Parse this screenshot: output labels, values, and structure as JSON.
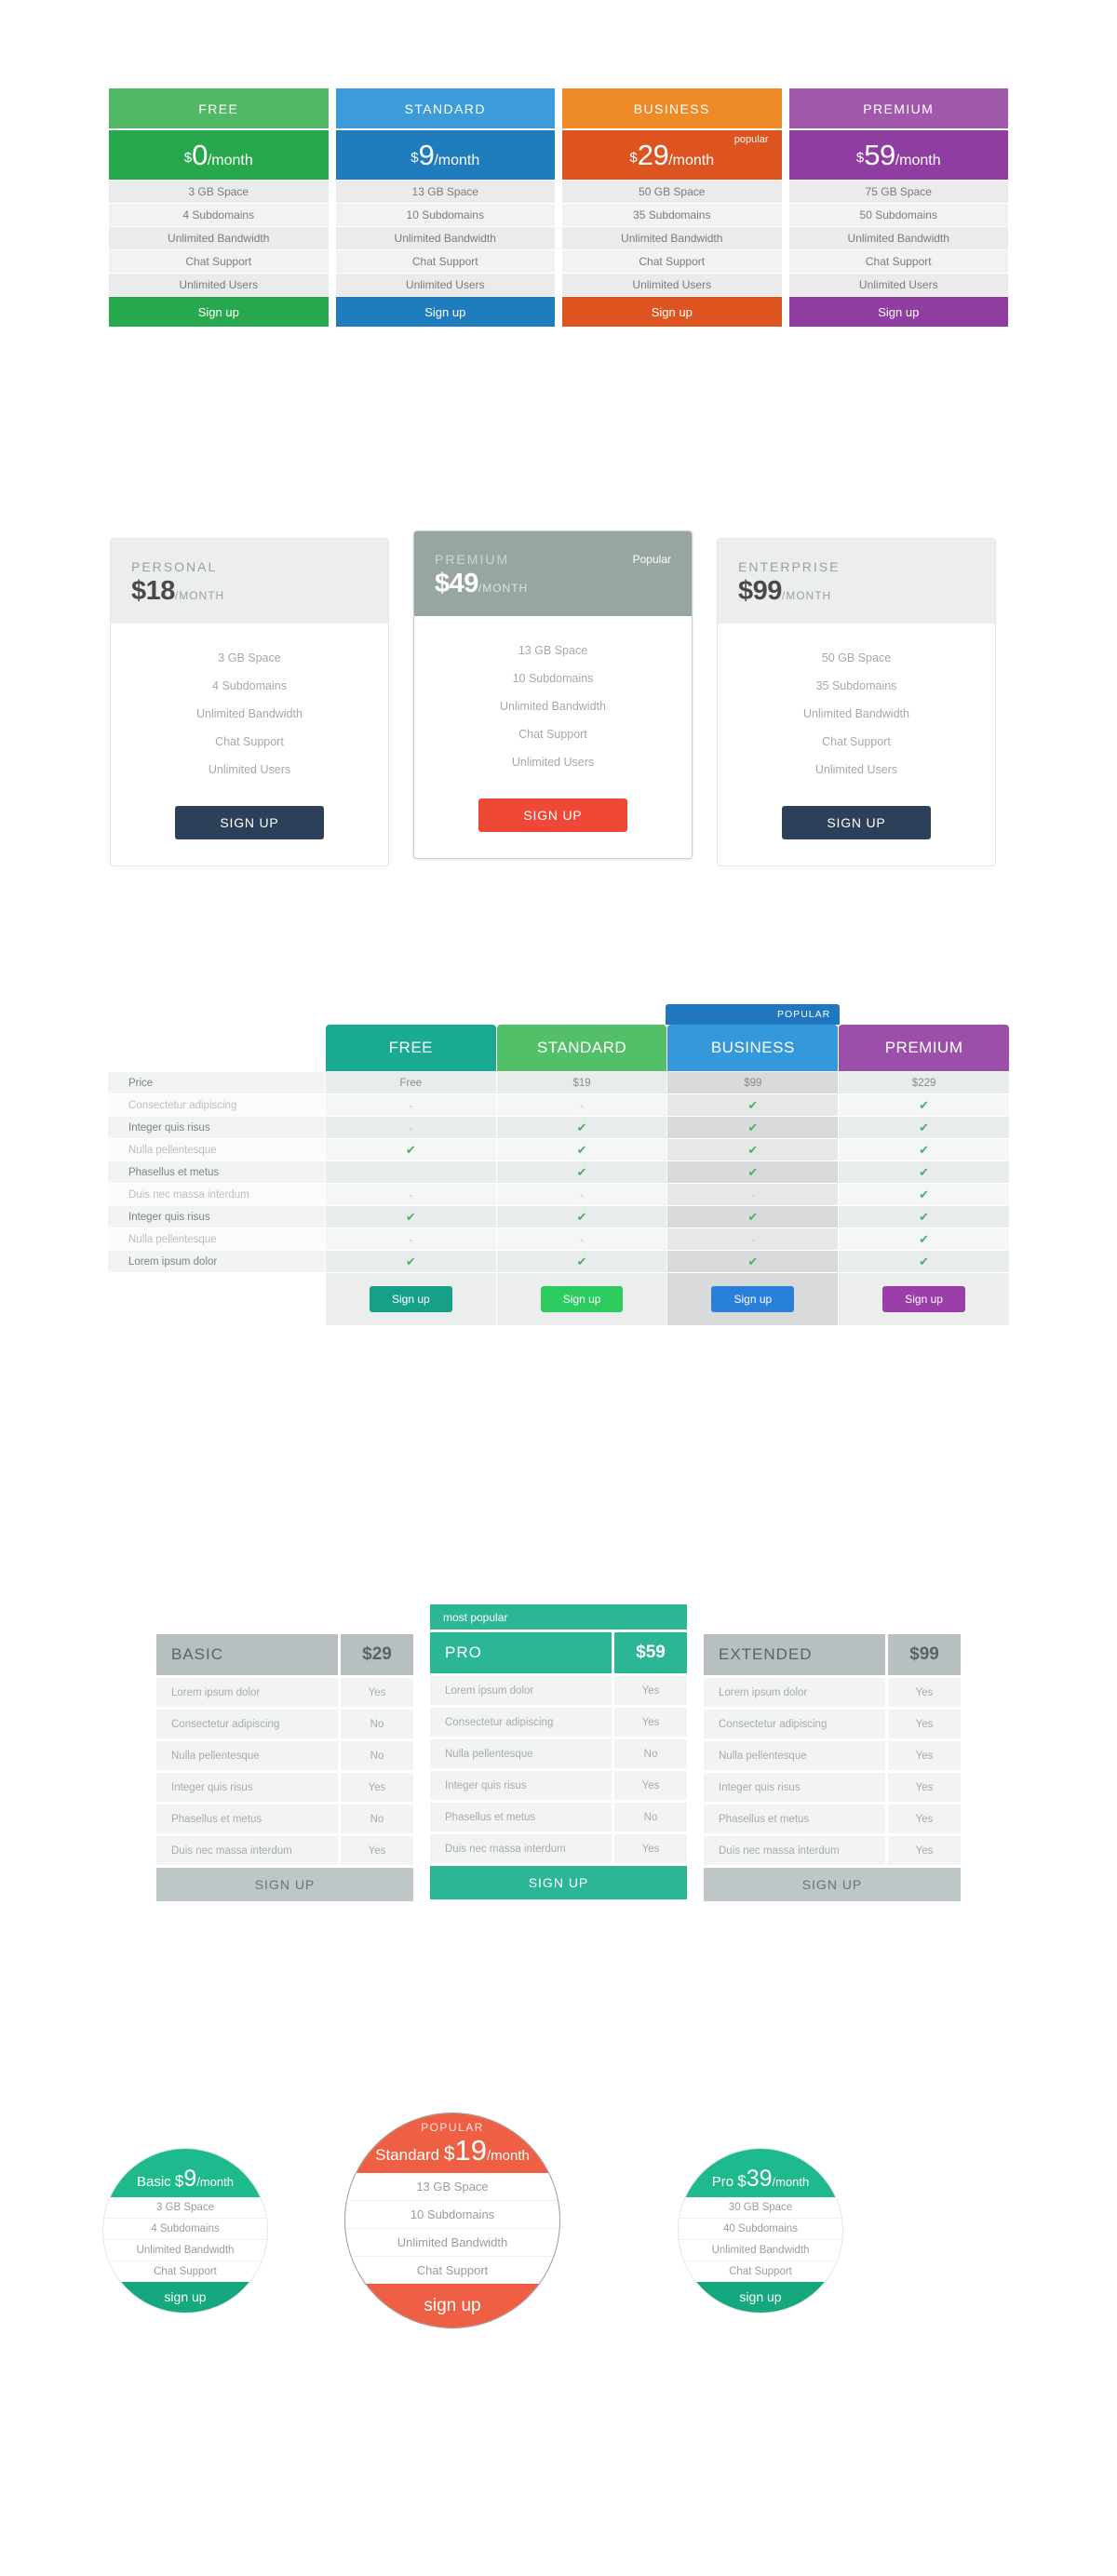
{
  "section1": {
    "columns": [
      {
        "name": "FREE",
        "currency": "$",
        "amount": "0",
        "period": "/month",
        "badge": "",
        "header_color": "#4fb968",
        "price_color": "#27a84c",
        "cta_color": "#27a84c",
        "features": [
          "3 GB Space",
          "4 Subdomains",
          "Unlimited Bandwidth",
          "Chat Support",
          "Unlimited Users"
        ],
        "cta": "Sign up"
      },
      {
        "name": "STANDARD",
        "currency": "$",
        "amount": "9",
        "period": "/month",
        "badge": "",
        "header_color": "#3b9cd9",
        "price_color": "#1f7dbd",
        "cta_color": "#1f7dbd",
        "features": [
          "13 GB Space",
          "10 Subdomains",
          "Unlimited Bandwidth",
          "Chat Support",
          "Unlimited Users"
        ],
        "cta": "Sign up"
      },
      {
        "name": "BUSINESS",
        "currency": "$",
        "amount": "29",
        "period": "/month",
        "badge": "popular",
        "header_color": "#ef8b26",
        "price_color": "#de5421",
        "cta_color": "#de5421",
        "features": [
          "50 GB Space",
          "35 Subdomains",
          "Unlimited Bandwidth",
          "Chat Support",
          "Unlimited Users"
        ],
        "cta": "Sign up"
      },
      {
        "name": "PREMIUM",
        "currency": "$",
        "amount": "59",
        "period": "/month",
        "badge": "",
        "header_color": "#a059ab",
        "price_color": "#8f3da0",
        "cta_color": "#8f3da0",
        "features": [
          "75 GB Space",
          "50 Subdomains",
          "Unlimited Bandwidth",
          "Chat Support",
          "Unlimited Users"
        ],
        "cta": "Sign up"
      }
    ]
  },
  "section2": {
    "cards": [
      {
        "name": "PERSONAL",
        "currency": "$",
        "amount": "18",
        "period": "/MONTH",
        "badge": "",
        "head_bg": "#eceeed",
        "name_color": "#9aa0a2",
        "price_color": "#4a4a4a",
        "btn_color": "#2c4159",
        "btn_text_color": "#ffffff",
        "features": [
          "3 GB Space",
          "4 Subdomains",
          "Unlimited Bandwidth",
          "Chat Support",
          "Unlimited Users"
        ],
        "cta": "SIGN UP"
      },
      {
        "name": "PREMIUM",
        "currency": "$",
        "amount": "49",
        "period": "/MONTH",
        "badge": "Popular",
        "head_bg": "#97a6a2",
        "name_color": "#ced6d4",
        "price_color": "#ffffff",
        "btn_color": "#ef4836",
        "btn_text_color": "#ffffff",
        "features": [
          "13 GB Space",
          "10 Subdomains",
          "Unlimited Bandwidth",
          "Chat Support",
          "Unlimited Users"
        ],
        "cta": "SIGN UP"
      },
      {
        "name": "ENTERPRISE",
        "currency": "$",
        "amount": "99",
        "period": "/MONTH",
        "badge": "",
        "head_bg": "#eceeed",
        "name_color": "#9aa0a2",
        "price_color": "#4a4a4a",
        "btn_color": "#2c4159",
        "btn_text_color": "#ffffff",
        "features": [
          "50 GB Space",
          "35 Subdomains",
          "Unlimited Bandwidth",
          "Chat Support",
          "Unlimited Users"
        ],
        "cta": "SIGN UP"
      }
    ]
  },
  "section3": {
    "plans": [
      {
        "name": "FREE",
        "header_color": "#1aa991",
        "btn_color": "#16a085",
        "ribbon": "",
        "highlight": false
      },
      {
        "name": "STANDARD",
        "header_color": "#53bf69",
        "btn_color": "#2ecc5f",
        "ribbon": "",
        "highlight": false
      },
      {
        "name": "BUSINESS",
        "header_color": "#3498db",
        "btn_color": "#2980d9",
        "ribbon": "POPULAR",
        "highlight": true
      },
      {
        "name": "PREMIUM",
        "header_color": "#9b4fa8",
        "btn_color": "#9b3fa8",
        "ribbon": "",
        "highlight": false
      }
    ],
    "rows": [
      {
        "label": "Price",
        "emphasis": true,
        "values": [
          "Free",
          "$19",
          "$99",
          "$229"
        ]
      },
      {
        "label": "Consectetur adipiscing",
        "emphasis": false,
        "values": [
          "-",
          "-",
          "yes",
          "yes"
        ]
      },
      {
        "label": "Integer quis risus",
        "emphasis": true,
        "values": [
          "-",
          "yes",
          "yes",
          "yes"
        ]
      },
      {
        "label": "Nulla pellentesque",
        "emphasis": false,
        "values": [
          "yes",
          "yes",
          "yes",
          "yes"
        ]
      },
      {
        "label": "Phasellus et metus",
        "emphasis": true,
        "values": [
          "",
          "yes",
          "yes",
          "yes"
        ]
      },
      {
        "label": "Duis nec massa interdum",
        "emphasis": false,
        "values": [
          "-",
          "-",
          "-",
          "yes"
        ]
      },
      {
        "label": "Integer quis risus",
        "emphasis": true,
        "values": [
          "yes",
          "yes",
          "yes",
          "yes"
        ]
      },
      {
        "label": "Nulla pellentesque",
        "emphasis": false,
        "values": [
          "-",
          "-",
          "-",
          "yes"
        ]
      },
      {
        "label": "Lorem ipsum dolor",
        "emphasis": true,
        "values": [
          "yes",
          "yes",
          "yes",
          "yes"
        ]
      }
    ],
    "cta": "Sign up",
    "tick_glyph": "✔",
    "dash_glyph": "-"
  },
  "section4": {
    "columns": [
      {
        "name": "BASIC",
        "price": "$29",
        "ribbon": "",
        "head_bg": "#b7bfc0",
        "name_color": "#5b6364",
        "amt_color": "#5b6364",
        "btn_color": "#bfc6c7",
        "btn_text_color": "#6b7374",
        "featured": false,
        "rows": [
          {
            "label": "Lorem ipsum dolor",
            "value": "Yes"
          },
          {
            "label": "Consectetur adipiscing",
            "value": "No"
          },
          {
            "label": "Nulla pellentesque",
            "value": "No"
          },
          {
            "label": "Integer quis risus",
            "value": "Yes"
          },
          {
            "label": "Phasellus et metus",
            "value": "No"
          },
          {
            "label": "Duis nec massa interdum",
            "value": "Yes"
          }
        ],
        "cta": "SIGN UP"
      },
      {
        "name": "PRO",
        "price": "$59",
        "ribbon": "most popular",
        "head_bg": "#2bb796",
        "name_color": "#ffffff",
        "amt_color": "#ffffff",
        "btn_color": "#2bb796",
        "btn_text_color": "#ffffff",
        "featured": true,
        "rows": [
          {
            "label": "Lorem ipsum dolor",
            "value": "Yes"
          },
          {
            "label": "Consectetur adipiscing",
            "value": "Yes"
          },
          {
            "label": "Nulla pellentesque",
            "value": "No"
          },
          {
            "label": "Integer quis risus",
            "value": "Yes"
          },
          {
            "label": "Phasellus et metus",
            "value": "No"
          },
          {
            "label": "Duis nec massa interdum",
            "value": "Yes"
          }
        ],
        "cta": "SIGN UP"
      },
      {
        "name": "EXTENDED",
        "price": "$99",
        "ribbon": "",
        "head_bg": "#b7bfc0",
        "name_color": "#5b6364",
        "amt_color": "#5b6364",
        "btn_color": "#bfc6c7",
        "btn_text_color": "#6b7374",
        "featured": false,
        "rows": [
          {
            "label": "Lorem ipsum dolor",
            "value": "Yes"
          },
          {
            "label": "Consectetur adipiscing",
            "value": "Yes"
          },
          {
            "label": "Nulla pellentesque",
            "value": "Yes"
          },
          {
            "label": "Integer quis risus",
            "value": "Yes"
          },
          {
            "label": "Phasellus et metus",
            "value": "Yes"
          },
          {
            "label": "Duis nec massa interdum",
            "value": "Yes"
          }
        ],
        "cta": "SIGN UP"
      }
    ]
  },
  "section5": {
    "circles": [
      {
        "name": "Basic",
        "currency": "$",
        "amount": "9",
        "period": "/month",
        "badge": "",
        "accent": "#1fb98e",
        "cta_bg": "#15a77e",
        "size": "small",
        "features": [
          "3 GB Space",
          "4 Subdomains",
          "Unlimited Bandwidth",
          "Chat Support"
        ],
        "cta": "sign up"
      },
      {
        "name": "Standard",
        "currency": "$",
        "amount": "19",
        "period": "/month",
        "badge": "POPULAR",
        "accent": "#ef5f43",
        "cta_bg": "#ef5f43",
        "size": "big",
        "features": [
          "13 GB Space",
          "10 Subdomains",
          "Unlimited Bandwidth",
          "Chat Support"
        ],
        "cta": "sign up"
      },
      {
        "name": "Pro",
        "currency": "$",
        "amount": "39",
        "period": "/month",
        "badge": "",
        "accent": "#1fb98e",
        "cta_bg": "#15a77e",
        "size": "small",
        "features": [
          "30 GB Space",
          "40 Subdomains",
          "Unlimited Bandwidth",
          "Chat Support"
        ],
        "cta": "sign up"
      }
    ]
  }
}
